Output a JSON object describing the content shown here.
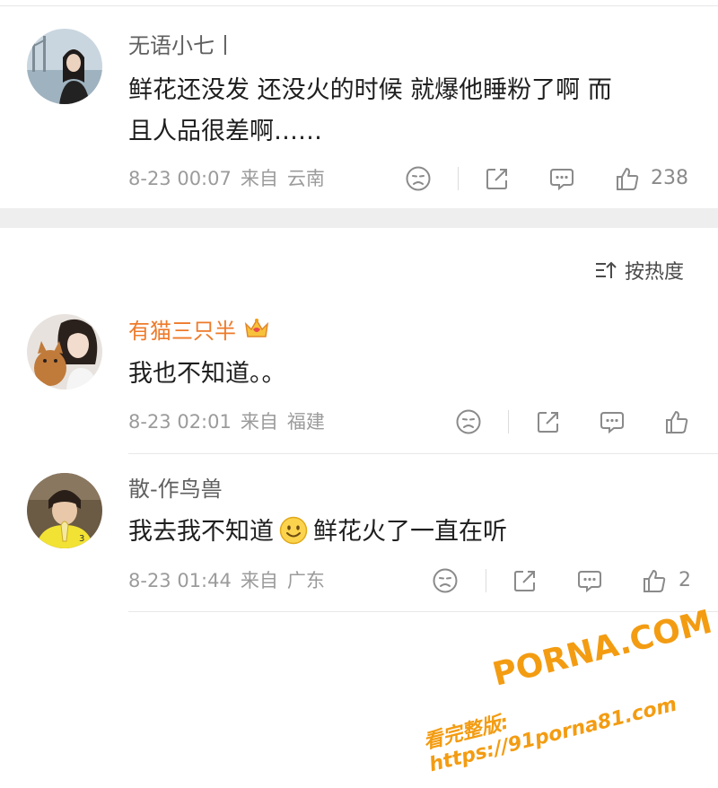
{
  "comments": [
    {
      "username": "无语小七丨",
      "text_line1": "鲜花还没发 还没火的时候 就爆他睡粉了啊 而",
      "text_line2": "且人品很差啊……",
      "date": "8-23 00:07",
      "from_label": "来自",
      "location": "云南",
      "likes": "238"
    },
    {
      "username": "有猫三只半",
      "vip": true,
      "text": "我也不知道。。",
      "date": "8-23 02:01",
      "from_label": "来自",
      "location": "福建",
      "likes": ""
    },
    {
      "username": "散-作鸟兽",
      "text_before": "我去我不知道",
      "emoji_icon": "smile-emoji-icon",
      "text_after": "鲜花火了一直在听",
      "date": "8-23 01:44",
      "from_label": "来自",
      "location": "广东",
      "likes": "2"
    }
  ],
  "sort": {
    "label": "按热度",
    "icon": "sort-icon"
  },
  "icons": [
    "dislike-face-icon",
    "share-icon",
    "comment-icon",
    "like-thumb-icon",
    "crown-icon"
  ],
  "colors": {
    "accent_orange": "#ee7a2a",
    "meta_gray": "#9b9b9b",
    "divider": "#eeeeee"
  },
  "watermark": {
    "line1": "PORNA.COM",
    "line2": "看完整版: https://91porna81.com"
  }
}
